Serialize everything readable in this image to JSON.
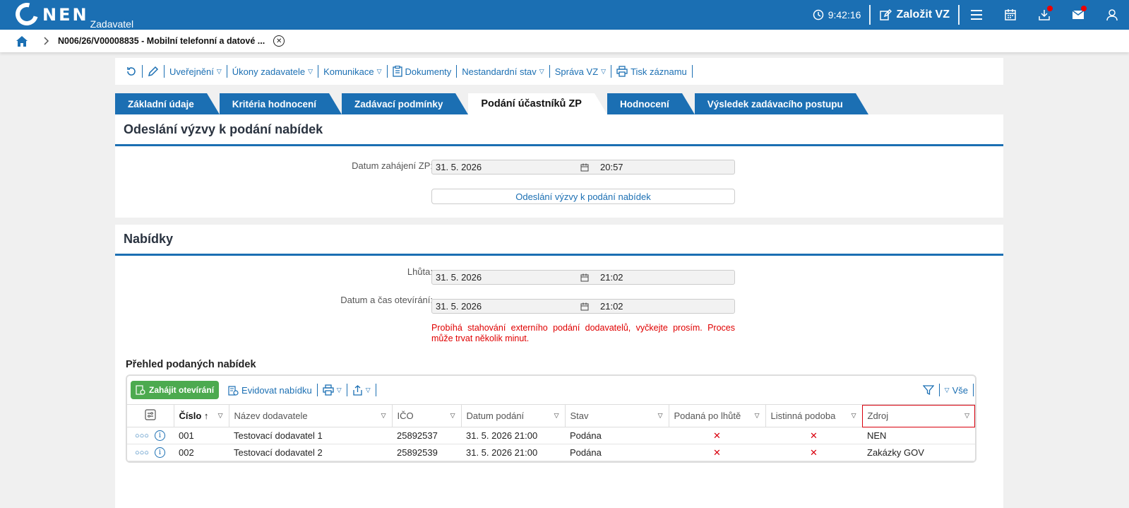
{
  "header": {
    "logo": "NEN",
    "role": "Zadavatel",
    "time": "9:42:16",
    "new_vz": "Založit VZ"
  },
  "breadcrumb": {
    "title": "N006/26/V00008835 - Mobilní telefonní a datové ..."
  },
  "toolbar": {
    "items": [
      "Uveřejnění",
      "Úkony zadavatele",
      "Komunikace",
      "Dokumenty",
      "Nestandardní stav",
      "Správa VZ",
      "Tisk záznamu"
    ]
  },
  "tabs": [
    "Základní údaje",
    "Kritéria hodnocení",
    "Zadávací podmínky",
    "Podání účastníků ZP",
    "Hodnocení",
    "Výsledek zadávacího postupu"
  ],
  "section1": {
    "title": "Odeslání výzvy k podání nabídek",
    "start_label": "Datum zahájení ZP:",
    "start_date": "31. 5. 2026",
    "start_time": "20:57",
    "send_button": "Odeslání výzvy k podání nabídek"
  },
  "section2": {
    "title": "Nabídky",
    "deadline_label": "Lhůta:",
    "deadline_date": "31. 5. 2026",
    "deadline_time": "21:02",
    "opening_label": "Datum a čas otevírání:",
    "opening_date": "31. 5. 2026",
    "opening_time": "21:02",
    "warning": "Probíhá stahování externího podání dodavatelů, vyčkejte prosím. Proces může trvat několik minut.",
    "subtitle": "Přehled podaných nabídek",
    "start_opening_button": "Zahájit otevírání",
    "register_offer": "Evidovat nabídku",
    "filter_all": "Vše",
    "columns": [
      "Číslo",
      "Název dodavatele",
      "IČO",
      "Datum podání",
      "Stav",
      "Podaná po lhůtě",
      "Listinná podoba",
      "Zdroj"
    ],
    "rows": [
      {
        "cislo": "001",
        "nazev": "Testovací dodavatel 1",
        "ico": "25892537",
        "datum": "31. 5. 2026 21:00",
        "stav": "Podána",
        "po_lhute": "✕",
        "listinna": "✕",
        "zdroj": "NEN"
      },
      {
        "cislo": "002",
        "nazev": "Testovací dodavatel 2",
        "ico": "25892539",
        "datum": "31. 5. 2026 21:00",
        "stav": "Podána",
        "po_lhute": "✕",
        "listinna": "✕",
        "zdroj": "Zakázky GOV"
      }
    ]
  }
}
